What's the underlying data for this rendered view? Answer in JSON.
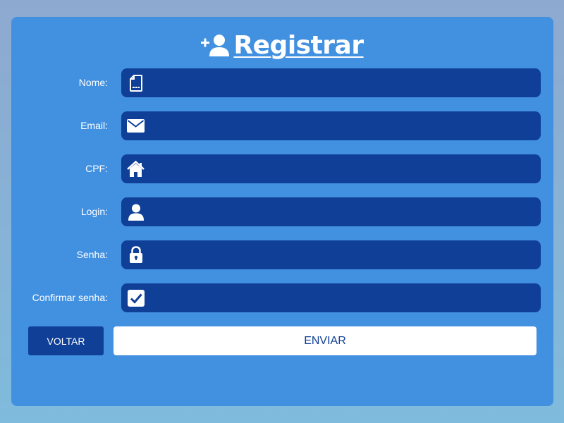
{
  "form": {
    "title": "Registrar",
    "title_icon": "add-user-icon",
    "fields": [
      {
        "label": "Nome:",
        "icon": "document-icon",
        "value": "",
        "placeholder": ""
      },
      {
        "label": "Email:",
        "icon": "envelope-icon",
        "value": "",
        "placeholder": ""
      },
      {
        "label": "CPF:",
        "icon": "home-icon",
        "value": "",
        "placeholder": ""
      },
      {
        "label": "Login:",
        "icon": "user-icon",
        "value": "",
        "placeholder": ""
      },
      {
        "label": "Senha:",
        "icon": "lock-icon",
        "value": "",
        "placeholder": ""
      },
      {
        "label": "Confirmar senha:",
        "icon": "checkbox-icon",
        "value": "",
        "placeholder": ""
      }
    ],
    "back_label": "VOLTAR",
    "send_label": "ENVIAR"
  },
  "colors": {
    "background": "#8ea9cf",
    "card": "#4290e0",
    "field": "#0f3f96",
    "text": "#ffffff"
  }
}
